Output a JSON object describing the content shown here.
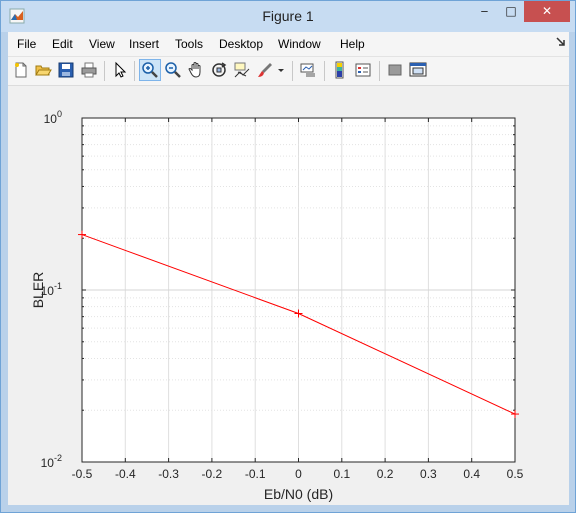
{
  "window": {
    "title": "Figure 1",
    "controls": {
      "minimize": "‒",
      "maximize": "□",
      "close": "✕"
    }
  },
  "menu": [
    "File",
    "Edit",
    "View",
    "Insert",
    "Tools",
    "Desktop",
    "Window",
    "Help"
  ],
  "toolbar": {
    "buttons": [
      {
        "name": "new-figure-icon"
      },
      {
        "name": "open-file-icon"
      },
      {
        "name": "save-icon"
      },
      {
        "name": "print-icon"
      },
      {
        "name": "pointer-icon"
      },
      {
        "name": "zoom-in-icon",
        "active": true
      },
      {
        "name": "zoom-out-icon"
      },
      {
        "name": "pan-icon"
      },
      {
        "name": "rotate-3d-icon"
      },
      {
        "name": "data-cursor-icon"
      },
      {
        "name": "brush-icon"
      },
      {
        "name": "link-plot-icon"
      },
      {
        "name": "colorbar-icon"
      },
      {
        "name": "legend-icon"
      },
      {
        "name": "hide-plot-tools-icon"
      },
      {
        "name": "show-plot-tools-icon"
      }
    ]
  },
  "chart_data": {
    "type": "line",
    "xlabel": "Eb/N0 (dB)",
    "ylabel": "BLER",
    "xlim": [
      -0.5,
      0.5
    ],
    "ylim": [
      0.01,
      1
    ],
    "yscale": "log",
    "x_ticks": [
      "-0.5",
      "-0.4",
      "-0.3",
      "-0.2",
      "-0.1",
      "0",
      "0.1",
      "0.2",
      "0.3",
      "0.4",
      "0.5"
    ],
    "y_ticks": [
      {
        "base": "10",
        "exp": "-2"
      },
      {
        "base": "10",
        "exp": "-1"
      },
      {
        "base": "10",
        "exp": "0"
      }
    ],
    "grid": true,
    "series": [
      {
        "x": [
          -0.5,
          0,
          0.5
        ],
        "y": [
          0.21,
          0.073,
          0.019
        ],
        "color": "#ff0000",
        "marker": "+"
      }
    ]
  }
}
